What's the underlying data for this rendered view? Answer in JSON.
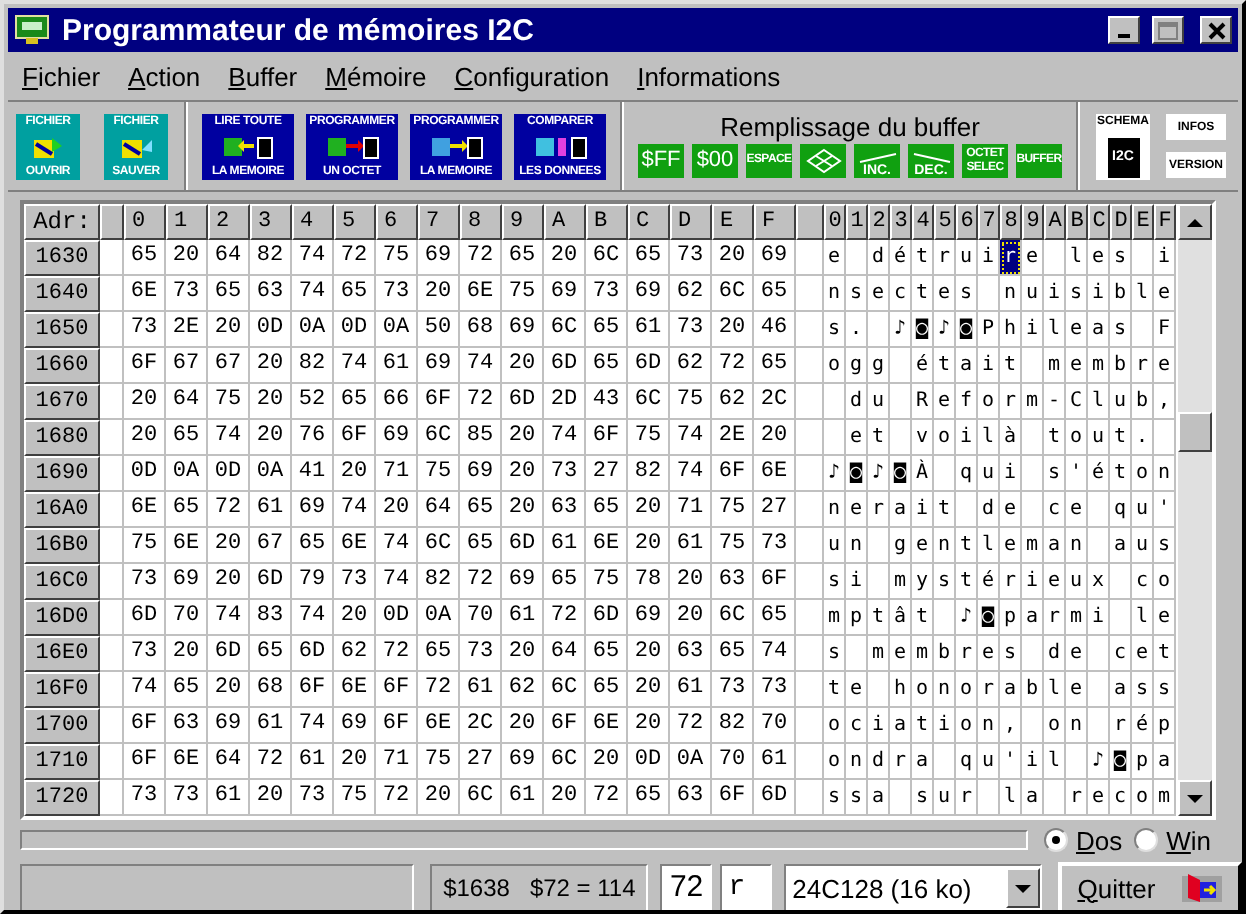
{
  "window": {
    "title": "Programmateur de mémoires I2C"
  },
  "menu": [
    "Fichier",
    "Action",
    "Buffer",
    "Mémoire",
    "Configuration",
    "Informations"
  ],
  "toolbar": {
    "file_buttons": [
      {
        "top": "FICHIER",
        "bottom": "OUVRIR"
      },
      {
        "top": "FICHIER",
        "bottom": "SAUVER"
      }
    ],
    "memory_buttons": [
      {
        "top": "LIRE TOUTE",
        "bottom": "LA MEMOIRE"
      },
      {
        "top": "PROGRAMMER",
        "bottom": "UN OCTET"
      },
      {
        "top": "PROGRAMMER",
        "bottom": "LA MEMOIRE"
      },
      {
        "top": "COMPARER",
        "bottom": "LES DONNEES"
      }
    ],
    "fill_group": {
      "title": "Remplissage du buffer",
      "buttons": [
        {
          "kind": "text",
          "label": "$FF"
        },
        {
          "kind": "text",
          "label": "$00"
        },
        {
          "kind": "text",
          "label": "ESPACE"
        },
        {
          "kind": "pattern"
        },
        {
          "kind": "ramp_up",
          "label": "INC."
        },
        {
          "kind": "ramp_down",
          "label": "DEC."
        },
        {
          "kind": "text",
          "label": "OCTET SELEC"
        },
        {
          "kind": "text",
          "label": "BUFFER"
        }
      ]
    },
    "schema": {
      "top": "SCHEMA",
      "bottom": "I2C"
    },
    "info_buttons": [
      "INFOS",
      "VERSION"
    ]
  },
  "grid": {
    "address_header": "Adr:",
    "hex_columns": [
      "0",
      "1",
      "2",
      "3",
      "4",
      "5",
      "6",
      "7",
      "8",
      "9",
      "A",
      "B",
      "C",
      "D",
      "E",
      "F"
    ],
    "ascii_columns": [
      {
        "label": "0",
        "selected": false
      },
      {
        "label": "1",
        "selected": false
      },
      {
        "label": "2",
        "selected": false
      },
      {
        "label": "3",
        "selected": false
      },
      {
        "label": "4",
        "selected": false
      },
      {
        "label": "5",
        "selected": false
      },
      {
        "label": "6",
        "selected": false
      },
      {
        "label": "7",
        "selected": false
      },
      {
        "label": "8",
        "selected": true
      },
      {
        "label": "9",
        "selected": false
      },
      {
        "label": "A",
        "selected": false
      },
      {
        "label": "B",
        "selected": false
      },
      {
        "label": "C",
        "selected": false
      },
      {
        "label": "D",
        "selected": false
      },
      {
        "label": "E",
        "selected": false
      },
      {
        "label": "F",
        "selected": false
      }
    ],
    "rows": [
      {
        "address": "1630",
        "selected": true,
        "hex": [
          "65",
          "20",
          "64",
          "82",
          "74",
          "72",
          "75",
          "69",
          "72",
          "65",
          "20",
          "6C",
          "65",
          "73",
          "20",
          "69"
        ],
        "ascii": [
          {
            "kind": "char",
            "text": "e"
          },
          {
            "kind": "blank"
          },
          {
            "kind": "char",
            "text": "d"
          },
          {
            "kind": "char",
            "text": "é"
          },
          {
            "kind": "char",
            "text": "t"
          },
          {
            "kind": "char",
            "text": "r"
          },
          {
            "kind": "char",
            "text": "u"
          },
          {
            "kind": "char",
            "text": "i"
          },
          {
            "kind": "char",
            "text": "r"
          },
          {
            "kind": "char",
            "text": "e"
          },
          {
            "kind": "blank"
          },
          {
            "kind": "char",
            "text": "l"
          },
          {
            "kind": "char",
            "text": "e"
          },
          {
            "kind": "char",
            "text": "s"
          },
          {
            "kind": "blank"
          },
          {
            "kind": "char",
            "text": "i"
          }
        ]
      },
      {
        "address": "1640",
        "selected": false,
        "hex": [
          "6E",
          "73",
          "65",
          "63",
          "74",
          "65",
          "73",
          "20",
          "6E",
          "75",
          "69",
          "73",
          "69",
          "62",
          "6C",
          "65"
        ],
        "ascii": [
          {
            "kind": "char",
            "text": "n"
          },
          {
            "kind": "char",
            "text": "s"
          },
          {
            "kind": "char",
            "text": "e"
          },
          {
            "kind": "char",
            "text": "c"
          },
          {
            "kind": "char",
            "text": "t"
          },
          {
            "kind": "char",
            "text": "e"
          },
          {
            "kind": "char",
            "text": "s"
          },
          {
            "kind": "blank"
          },
          {
            "kind": "char",
            "text": "n"
          },
          {
            "kind": "char",
            "text": "u"
          },
          {
            "kind": "char",
            "text": "i"
          },
          {
            "kind": "char",
            "text": "s"
          },
          {
            "kind": "char",
            "text": "i"
          },
          {
            "kind": "char",
            "text": "b"
          },
          {
            "kind": "char",
            "text": "l"
          },
          {
            "kind": "char",
            "text": "e"
          }
        ]
      },
      {
        "address": "1650",
        "selected": false,
        "hex": [
          "73",
          "2E",
          "20",
          "0D",
          "0A",
          "0D",
          "0A",
          "50",
          "68",
          "69",
          "6C",
          "65",
          "61",
          "73",
          "20",
          "46"
        ],
        "ascii": [
          {
            "kind": "char",
            "text": "s"
          },
          {
            "kind": "char",
            "text": "."
          },
          {
            "kind": "blank"
          },
          {
            "kind": "char",
            "text": "♪"
          },
          {
            "kind": "char",
            "text": "◙"
          },
          {
            "kind": "char",
            "text": "♪"
          },
          {
            "kind": "char",
            "text": "◙"
          },
          {
            "kind": "char",
            "text": "P"
          },
          {
            "kind": "char",
            "text": "h"
          },
          {
            "kind": "char",
            "text": "i"
          },
          {
            "kind": "char",
            "text": "l"
          },
          {
            "kind": "char",
            "text": "e"
          },
          {
            "kind": "char",
            "text": "a"
          },
          {
            "kind": "char",
            "text": "s"
          },
          {
            "kind": "blank"
          },
          {
            "kind": "char",
            "text": "F"
          }
        ]
      },
      {
        "address": "1660",
        "selected": false,
        "hex": [
          "6F",
          "67",
          "67",
          "20",
          "82",
          "74",
          "61",
          "69",
          "74",
          "20",
          "6D",
          "65",
          "6D",
          "62",
          "72",
          "65"
        ],
        "ascii": [
          {
            "kind": "char",
            "text": "o"
          },
          {
            "kind": "char",
            "text": "g"
          },
          {
            "kind": "char",
            "text": "g"
          },
          {
            "kind": "blank"
          },
          {
            "kind": "char",
            "text": "é"
          },
          {
            "kind": "char",
            "text": "t"
          },
          {
            "kind": "char",
            "text": "a"
          },
          {
            "kind": "char",
            "text": "i"
          },
          {
            "kind": "char",
            "text": "t"
          },
          {
            "kind": "blank"
          },
          {
            "kind": "char",
            "text": "m"
          },
          {
            "kind": "char",
            "text": "e"
          },
          {
            "kind": "char",
            "text": "m"
          },
          {
            "kind": "char",
            "text": "b"
          },
          {
            "kind": "char",
            "text": "r"
          },
          {
            "kind": "char",
            "text": "e"
          }
        ]
      },
      {
        "address": "1670",
        "selected": false,
        "hex": [
          "20",
          "64",
          "75",
          "20",
          "52",
          "65",
          "66",
          "6F",
          "72",
          "6D",
          "2D",
          "43",
          "6C",
          "75",
          "62",
          "2C"
        ],
        "ascii": [
          {
            "kind": "blank"
          },
          {
            "kind": "char",
            "text": "d"
          },
          {
            "kind": "char",
            "text": "u"
          },
          {
            "kind": "blank"
          },
          {
            "kind": "char",
            "text": "R"
          },
          {
            "kind": "char",
            "text": "e"
          },
          {
            "kind": "char",
            "text": "f"
          },
          {
            "kind": "char",
            "text": "o"
          },
          {
            "kind": "char",
            "text": "r"
          },
          {
            "kind": "char",
            "text": "m"
          },
          {
            "kind": "char",
            "text": "-"
          },
          {
            "kind": "char",
            "text": "C"
          },
          {
            "kind": "char",
            "text": "l"
          },
          {
            "kind": "char",
            "text": "u"
          },
          {
            "kind": "char",
            "text": "b"
          },
          {
            "kind": "char",
            "text": ","
          }
        ]
      },
      {
        "address": "1680",
        "selected": false,
        "hex": [
          "20",
          "65",
          "74",
          "20",
          "76",
          "6F",
          "69",
          "6C",
          "85",
          "20",
          "74",
          "6F",
          "75",
          "74",
          "2E",
          "20"
        ],
        "ascii": [
          {
            "kind": "blank"
          },
          {
            "kind": "char",
            "text": "e"
          },
          {
            "kind": "char",
            "text": "t"
          },
          {
            "kind": "blank"
          },
          {
            "kind": "char",
            "text": "v"
          },
          {
            "kind": "char",
            "text": "o"
          },
          {
            "kind": "char",
            "text": "i"
          },
          {
            "kind": "char",
            "text": "l"
          },
          {
            "kind": "char",
            "text": "à"
          },
          {
            "kind": "blank"
          },
          {
            "kind": "char",
            "text": "t"
          },
          {
            "kind": "char",
            "text": "o"
          },
          {
            "kind": "char",
            "text": "u"
          },
          {
            "kind": "char",
            "text": "t"
          },
          {
            "kind": "char",
            "text": "."
          },
          {
            "kind": "blank"
          }
        ]
      },
      {
        "address": "1690",
        "selected": false,
        "hex": [
          "0D",
          "0A",
          "0D",
          "0A",
          "41",
          "20",
          "71",
          "75",
          "69",
          "20",
          "73",
          "27",
          "82",
          "74",
          "6F",
          "6E"
        ],
        "ascii": [
          {
            "kind": "char",
            "text": "♪"
          },
          {
            "kind": "char",
            "text": "◙"
          },
          {
            "kind": "char",
            "text": "♪"
          },
          {
            "kind": "char",
            "text": "◙"
          },
          {
            "kind": "char",
            "text": "À"
          },
          {
            "kind": "blank"
          },
          {
            "kind": "char",
            "text": "q"
          },
          {
            "kind": "char",
            "text": "u"
          },
          {
            "kind": "char",
            "text": "i"
          },
          {
            "kind": "blank"
          },
          {
            "kind": "char",
            "text": "s"
          },
          {
            "kind": "char",
            "text": "'"
          },
          {
            "kind": "char",
            "text": "é"
          },
          {
            "kind": "char",
            "text": "t"
          },
          {
            "kind": "char",
            "text": "o"
          },
          {
            "kind": "char",
            "text": "n"
          }
        ]
      },
      {
        "address": "16A0",
        "selected": false,
        "hex": [
          "6E",
          "65",
          "72",
          "61",
          "69",
          "74",
          "20",
          "64",
          "65",
          "20",
          "63",
          "65",
          "20",
          "71",
          "75",
          "27"
        ],
        "ascii": [
          {
            "kind": "char",
            "text": "n"
          },
          {
            "kind": "char",
            "text": "e"
          },
          {
            "kind": "char",
            "text": "r"
          },
          {
            "kind": "char",
            "text": "a"
          },
          {
            "kind": "char",
            "text": "i"
          },
          {
            "kind": "char",
            "text": "t"
          },
          {
            "kind": "blank"
          },
          {
            "kind": "char",
            "text": "d"
          },
          {
            "kind": "char",
            "text": "e"
          },
          {
            "kind": "blank"
          },
          {
            "kind": "char",
            "text": "c"
          },
          {
            "kind": "char",
            "text": "e"
          },
          {
            "kind": "blank"
          },
          {
            "kind": "char",
            "text": "q"
          },
          {
            "kind": "char",
            "text": "u"
          },
          {
            "kind": "char",
            "text": "'"
          }
        ]
      },
      {
        "address": "16B0",
        "selected": false,
        "hex": [
          "75",
          "6E",
          "20",
          "67",
          "65",
          "6E",
          "74",
          "6C",
          "65",
          "6D",
          "61",
          "6E",
          "20",
          "61",
          "75",
          "73"
        ],
        "ascii": [
          {
            "kind": "char",
            "text": "u"
          },
          {
            "kind": "char",
            "text": "n"
          },
          {
            "kind": "blank"
          },
          {
            "kind": "char",
            "text": "g"
          },
          {
            "kind": "char",
            "text": "e"
          },
          {
            "kind": "char",
            "text": "n"
          },
          {
            "kind": "char",
            "text": "t"
          },
          {
            "kind": "char",
            "text": "l"
          },
          {
            "kind": "char",
            "text": "e"
          },
          {
            "kind": "char",
            "text": "m"
          },
          {
            "kind": "char",
            "text": "a"
          },
          {
            "kind": "char",
            "text": "n"
          },
          {
            "kind": "blank"
          },
          {
            "kind": "char",
            "text": "a"
          },
          {
            "kind": "char",
            "text": "u"
          },
          {
            "kind": "char",
            "text": "s"
          }
        ]
      },
      {
        "address": "16C0",
        "selected": false,
        "hex": [
          "73",
          "69",
          "20",
          "6D",
          "79",
          "73",
          "74",
          "82",
          "72",
          "69",
          "65",
          "75",
          "78",
          "20",
          "63",
          "6F"
        ],
        "ascii": [
          {
            "kind": "char",
            "text": "s"
          },
          {
            "kind": "char",
            "text": "i"
          },
          {
            "kind": "blank"
          },
          {
            "kind": "char",
            "text": "m"
          },
          {
            "kind": "char",
            "text": "y"
          },
          {
            "kind": "char",
            "text": "s"
          },
          {
            "kind": "char",
            "text": "t"
          },
          {
            "kind": "char",
            "text": "é"
          },
          {
            "kind": "char",
            "text": "r"
          },
          {
            "kind": "char",
            "text": "i"
          },
          {
            "kind": "char",
            "text": "e"
          },
          {
            "kind": "char",
            "text": "u"
          },
          {
            "kind": "char",
            "text": "x"
          },
          {
            "kind": "blank"
          },
          {
            "kind": "char",
            "text": "c"
          },
          {
            "kind": "char",
            "text": "o"
          }
        ]
      },
      {
        "address": "16D0",
        "selected": false,
        "hex": [
          "6D",
          "70",
          "74",
          "83",
          "74",
          "20",
          "0D",
          "0A",
          "70",
          "61",
          "72",
          "6D",
          "69",
          "20",
          "6C",
          "65"
        ],
        "ascii": [
          {
            "kind": "char",
            "text": "m"
          },
          {
            "kind": "char",
            "text": "p"
          },
          {
            "kind": "char",
            "text": "t"
          },
          {
            "kind": "char",
            "text": "â"
          },
          {
            "kind": "char",
            "text": "t"
          },
          {
            "kind": "blank"
          },
          {
            "kind": "char",
            "text": "♪"
          },
          {
            "kind": "char",
            "text": "◙"
          },
          {
            "kind": "char",
            "text": "p"
          },
          {
            "kind": "char",
            "text": "a"
          },
          {
            "kind": "char",
            "text": "r"
          },
          {
            "kind": "char",
            "text": "m"
          },
          {
            "kind": "char",
            "text": "i"
          },
          {
            "kind": "blank"
          },
          {
            "kind": "char",
            "text": "l"
          },
          {
            "kind": "char",
            "text": "e"
          }
        ]
      },
      {
        "address": "16E0",
        "selected": false,
        "hex": [
          "73",
          "20",
          "6D",
          "65",
          "6D",
          "62",
          "72",
          "65",
          "73",
          "20",
          "64",
          "65",
          "20",
          "63",
          "65",
          "74"
        ],
        "ascii": [
          {
            "kind": "char",
            "text": "s"
          },
          {
            "kind": "blank"
          },
          {
            "kind": "char",
            "text": "m"
          },
          {
            "kind": "char",
            "text": "e"
          },
          {
            "kind": "char",
            "text": "m"
          },
          {
            "kind": "char",
            "text": "b"
          },
          {
            "kind": "char",
            "text": "r"
          },
          {
            "kind": "char",
            "text": "e"
          },
          {
            "kind": "char",
            "text": "s"
          },
          {
            "kind": "blank"
          },
          {
            "kind": "char",
            "text": "d"
          },
          {
            "kind": "char",
            "text": "e"
          },
          {
            "kind": "blank"
          },
          {
            "kind": "char",
            "text": "c"
          },
          {
            "kind": "char",
            "text": "e"
          },
          {
            "kind": "char",
            "text": "t"
          }
        ]
      },
      {
        "address": "16F0",
        "selected": false,
        "hex": [
          "74",
          "65",
          "20",
          "68",
          "6F",
          "6E",
          "6F",
          "72",
          "61",
          "62",
          "6C",
          "65",
          "20",
          "61",
          "73",
          "73"
        ],
        "ascii": [
          {
            "kind": "char",
            "text": "t"
          },
          {
            "kind": "char",
            "text": "e"
          },
          {
            "kind": "blank"
          },
          {
            "kind": "char",
            "text": "h"
          },
          {
            "kind": "char",
            "text": "o"
          },
          {
            "kind": "char",
            "text": "n"
          },
          {
            "kind": "char",
            "text": "o"
          },
          {
            "kind": "char",
            "text": "r"
          },
          {
            "kind": "char",
            "text": "a"
          },
          {
            "kind": "char",
            "text": "b"
          },
          {
            "kind": "char",
            "text": "l"
          },
          {
            "kind": "char",
            "text": "e"
          },
          {
            "kind": "blank"
          },
          {
            "kind": "char",
            "text": "a"
          },
          {
            "kind": "char",
            "text": "s"
          },
          {
            "kind": "char",
            "text": "s"
          }
        ]
      },
      {
        "address": "1700",
        "selected": false,
        "hex": [
          "6F",
          "63",
          "69",
          "61",
          "74",
          "69",
          "6F",
          "6E",
          "2C",
          "20",
          "6F",
          "6E",
          "20",
          "72",
          "82",
          "70"
        ],
        "ascii": [
          {
            "kind": "char",
            "text": "o"
          },
          {
            "kind": "char",
            "text": "c"
          },
          {
            "kind": "char",
            "text": "i"
          },
          {
            "kind": "char",
            "text": "a"
          },
          {
            "kind": "char",
            "text": "t"
          },
          {
            "kind": "char",
            "text": "i"
          },
          {
            "kind": "char",
            "text": "o"
          },
          {
            "kind": "char",
            "text": "n"
          },
          {
            "kind": "char",
            "text": ","
          },
          {
            "kind": "blank"
          },
          {
            "kind": "char",
            "text": "o"
          },
          {
            "kind": "char",
            "text": "n"
          },
          {
            "kind": "blank"
          },
          {
            "kind": "char",
            "text": "r"
          },
          {
            "kind": "char",
            "text": "é"
          },
          {
            "kind": "char",
            "text": "p"
          }
        ]
      },
      {
        "address": "1710",
        "selected": false,
        "hex": [
          "6F",
          "6E",
          "64",
          "72",
          "61",
          "20",
          "71",
          "75",
          "27",
          "69",
          "6C",
          "20",
          "0D",
          "0A",
          "70",
          "61"
        ],
        "ascii": [
          {
            "kind": "char",
            "text": "o"
          },
          {
            "kind": "char",
            "text": "n"
          },
          {
            "kind": "char",
            "text": "d"
          },
          {
            "kind": "char",
            "text": "r"
          },
          {
            "kind": "char",
            "text": "a"
          },
          {
            "kind": "blank"
          },
          {
            "kind": "char",
            "text": "q"
          },
          {
            "kind": "char",
            "text": "u"
          },
          {
            "kind": "char",
            "text": "'"
          },
          {
            "kind": "char",
            "text": "i"
          },
          {
            "kind": "char",
            "text": "l"
          },
          {
            "kind": "blank"
          },
          {
            "kind": "char",
            "text": "♪"
          },
          {
            "kind": "char",
            "text": "◙"
          },
          {
            "kind": "char",
            "text": "p"
          },
          {
            "kind": "char",
            "text": "a"
          }
        ]
      },
      {
        "address": "1720",
        "selected": false,
        "hex": [
          "73",
          "73",
          "61",
          "20",
          "73",
          "75",
          "72",
          "20",
          "6C",
          "61",
          "20",
          "72",
          "65",
          "63",
          "6F",
          "6D"
        ],
        "ascii": [
          {
            "kind": "char",
            "text": "s"
          },
          {
            "kind": "char",
            "text": "s"
          },
          {
            "kind": "char",
            "text": "a"
          },
          {
            "kind": "blank"
          },
          {
            "kind": "char",
            "text": "s"
          },
          {
            "kind": "char",
            "text": "u"
          },
          {
            "kind": "char",
            "text": "r"
          },
          {
            "kind": "blank"
          },
          {
            "kind": "char",
            "text": "l"
          },
          {
            "kind": "char",
            "text": "a"
          },
          {
            "kind": "blank"
          },
          {
            "kind": "char",
            "text": "r"
          },
          {
            "kind": "char",
            "text": "e"
          },
          {
            "kind": "char",
            "text": "c"
          },
          {
            "kind": "char",
            "text": "o"
          },
          {
            "kind": "char",
            "text": "m"
          }
        ]
      }
    ]
  },
  "encoding_options": [
    {
      "label": "Dos",
      "selected": true
    },
    {
      "label": "Win",
      "selected": false
    }
  ],
  "status": {
    "address": "$1638",
    "value": "$72 = 114",
    "hex_field": "72",
    "char_field": "r",
    "memory_type": "24C128 (16 ko)",
    "quit_button": "Quitter"
  }
}
